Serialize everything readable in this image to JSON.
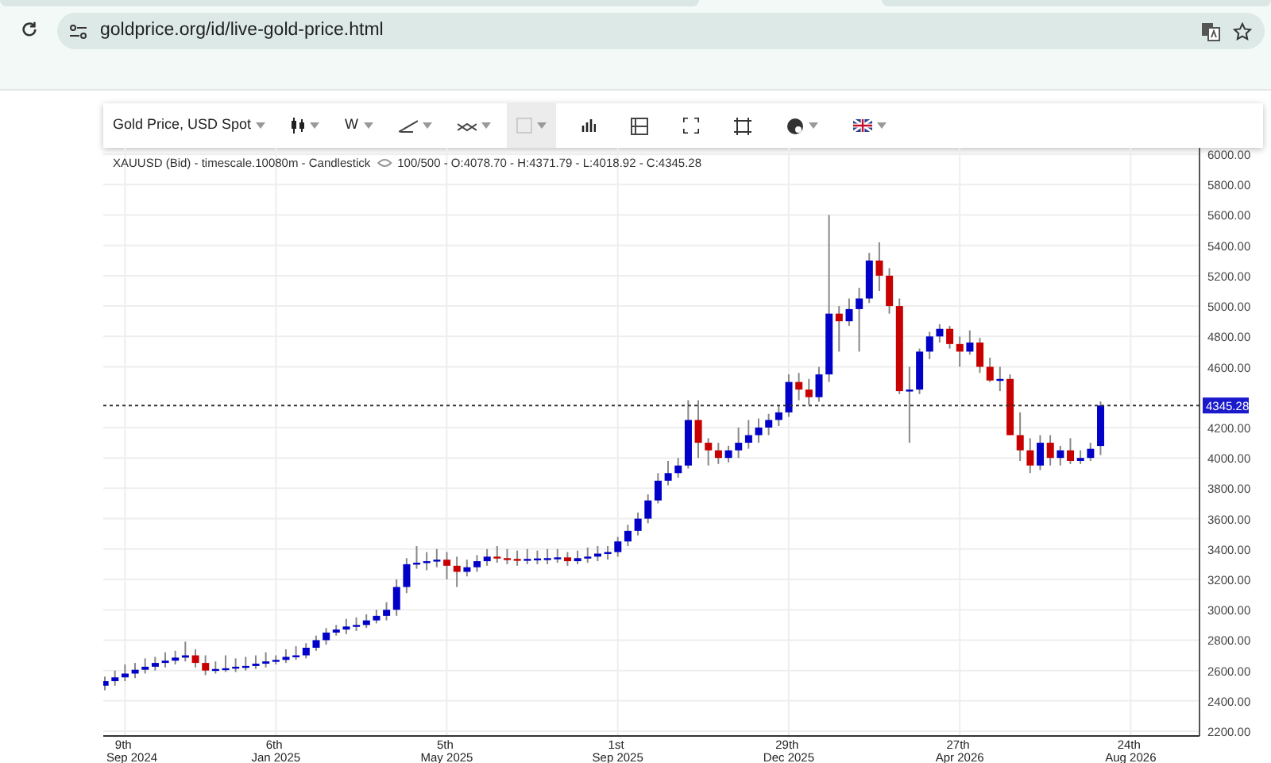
{
  "browser": {
    "url": "goldprice.org/id/live-gold-price.html"
  },
  "toolbar": {
    "symbol": "Gold Price, USD Spot",
    "interval": "W"
  },
  "chart": {
    "legend": "XAUUSD (Bid) - timescale.10080m - Candlestick",
    "legend_values": "100/500 - O:4078.70 - H:4371.79 - L:4018.92 - C:4345.28",
    "chart_data": {
      "type": "candlestick",
      "ylim": [
        2169,
        6042
      ],
      "grid": true,
      "ref_lines": [
        {
          "axis": "y",
          "value": 4345.28,
          "label": "4345.28"
        }
      ],
      "categories": [
        null,
        null,
        "9th Sep 2024",
        null,
        null,
        null,
        null,
        null,
        null,
        null,
        null,
        null,
        null,
        null,
        null,
        null,
        null,
        "6th Jan 2025",
        null,
        null,
        null,
        null,
        null,
        null,
        null,
        null,
        null,
        null,
        null,
        null,
        null,
        null,
        null,
        null,
        "5th May 2025",
        null,
        null,
        null,
        null,
        null,
        null,
        null,
        null,
        null,
        null,
        null,
        null,
        null,
        null,
        null,
        null,
        "1st Sep 2025",
        null,
        null,
        null,
        null,
        null,
        null,
        null,
        null,
        null,
        null,
        null,
        null,
        null,
        null,
        null,
        null,
        "29th Dec 2025",
        null,
        null,
        null,
        null,
        null,
        null,
        null,
        null,
        null,
        null,
        null,
        null,
        null,
        null,
        null,
        null,
        "27th Apr 2026",
        null,
        null,
        null,
        null,
        null,
        null,
        null,
        null,
        null,
        null,
        null,
        null,
        null,
        null,
        null,
        null,
        "24th Aug 2026",
        null,
        null,
        null,
        null,
        null,
        null
      ],
      "yticks": [
        {
          "value": 6000,
          "label": "6000.00"
        },
        {
          "value": 5800,
          "label": "5800.00"
        },
        {
          "value": 5600,
          "label": "5600.00"
        },
        {
          "value": 5400,
          "label": "5400.00"
        },
        {
          "value": 5200,
          "label": "5200.00"
        },
        {
          "value": 5000,
          "label": "5000.00"
        },
        {
          "value": 4800,
          "label": "4800.00"
        },
        {
          "value": 4600,
          "label": "4600.00"
        },
        {
          "value": 4200,
          "label": "4200.00"
        },
        {
          "value": 4000,
          "label": "4000.00"
        },
        {
          "value": 3800,
          "label": "3800.00"
        },
        {
          "value": 3600,
          "label": "3600.00"
        },
        {
          "value": 3400,
          "label": "3400.00"
        },
        {
          "value": 3200,
          "label": "3200.00"
        },
        {
          "value": 3000,
          "label": "3000.00"
        },
        {
          "value": 2800,
          "label": "2800.00"
        },
        {
          "value": 2600,
          "label": "2600.00"
        },
        {
          "value": 2400,
          "label": "2400.00"
        },
        {
          "value": 2200,
          "label": "2200.00"
        }
      ],
      "ohlc": [
        [
          2500,
          2560,
          2470,
          2530
        ],
        [
          2530,
          2600,
          2500,
          2555
        ],
        [
          2555,
          2640,
          2530,
          2580
        ],
        [
          2580,
          2650,
          2550,
          2605
        ],
        [
          2605,
          2680,
          2580,
          2625
        ],
        [
          2625,
          2690,
          2600,
          2650
        ],
        [
          2650,
          2720,
          2620,
          2665
        ],
        [
          2665,
          2730,
          2640,
          2685
        ],
        [
          2685,
          2790,
          2660,
          2700
        ],
        [
          2700,
          2740,
          2620,
          2650
        ],
        [
          2650,
          2700,
          2570,
          2600
        ],
        [
          2600,
          2660,
          2580,
          2610
        ],
        [
          2610,
          2700,
          2590,
          2615
        ],
        [
          2615,
          2680,
          2590,
          2625
        ],
        [
          2625,
          2690,
          2600,
          2630
        ],
        [
          2630,
          2700,
          2610,
          2645
        ],
        [
          2645,
          2720,
          2620,
          2660
        ],
        [
          2660,
          2700,
          2640,
          2670
        ],
        [
          2670,
          2740,
          2650,
          2690
        ],
        [
          2690,
          2760,
          2670,
          2700
        ],
        [
          2700,
          2780,
          2680,
          2750
        ],
        [
          2750,
          2830,
          2730,
          2800
        ],
        [
          2800,
          2880,
          2770,
          2850
        ],
        [
          2850,
          2900,
          2830,
          2870
        ],
        [
          2870,
          2940,
          2840,
          2890
        ],
        [
          2890,
          2950,
          2860,
          2900
        ],
        [
          2900,
          2970,
          2880,
          2930
        ],
        [
          2930,
          3000,
          2910,
          2960
        ],
        [
          2960,
          3050,
          2930,
          3000
        ],
        [
          3000,
          3200,
          2960,
          3150
        ],
        [
          3150,
          3340,
          3110,
          3300
        ],
        [
          3300,
          3420,
          3270,
          3310
        ],
        [
          3310,
          3380,
          3260,
          3320
        ],
        [
          3320,
          3400,
          3280,
          3330
        ],
        [
          3330,
          3380,
          3200,
          3290
        ],
        [
          3290,
          3350,
          3150,
          3250
        ],
        [
          3250,
          3330,
          3220,
          3280
        ],
        [
          3280,
          3360,
          3250,
          3320
        ],
        [
          3320,
          3400,
          3290,
          3350
        ],
        [
          3350,
          3420,
          3310,
          3340
        ],
        [
          3340,
          3400,
          3300,
          3335
        ],
        [
          3335,
          3390,
          3290,
          3330
        ],
        [
          3330,
          3400,
          3300,
          3335
        ],
        [
          3335,
          3390,
          3300,
          3338
        ],
        [
          3338,
          3400,
          3300,
          3340
        ],
        [
          3340,
          3400,
          3310,
          3345
        ],
        [
          3345,
          3380,
          3290,
          3320
        ],
        [
          3320,
          3390,
          3300,
          3340
        ],
        [
          3340,
          3410,
          3310,
          3350
        ],
        [
          3350,
          3420,
          3320,
          3370
        ],
        [
          3370,
          3420,
          3330,
          3380
        ],
        [
          3380,
          3480,
          3350,
          3450
        ],
        [
          3450,
          3560,
          3420,
          3520
        ],
        [
          3520,
          3640,
          3490,
          3600
        ],
        [
          3600,
          3760,
          3570,
          3720
        ],
        [
          3720,
          3900,
          3700,
          3850
        ],
        [
          3850,
          3980,
          3820,
          3900
        ],
        [
          3900,
          4000,
          3870,
          3950
        ],
        [
          3950,
          4380,
          3930,
          4250
        ],
        [
          4250,
          4380,
          4000,
          4100
        ],
        [
          4100,
          4130,
          3950,
          4050
        ],
        [
          4050,
          4100,
          3960,
          4000
        ],
        [
          4000,
          4080,
          3970,
          4050
        ],
        [
          4050,
          4200,
          4000,
          4100
        ],
        [
          4100,
          4250,
          4060,
          4150
        ],
        [
          4150,
          4260,
          4100,
          4200
        ],
        [
          4200,
          4290,
          4150,
          4250
        ],
        [
          4250,
          4340,
          4210,
          4300
        ],
        [
          4300,
          4550,
          4270,
          4500
        ],
        [
          4500,
          4560,
          4380,
          4450
        ],
        [
          4450,
          4520,
          4350,
          4400
        ],
        [
          4400,
          4600,
          4370,
          4550
        ],
        [
          4550,
          5600,
          4500,
          4950
        ],
        [
          4950,
          5000,
          4700,
          4900
        ],
        [
          4900,
          5050,
          4870,
          4980
        ],
        [
          4980,
          5120,
          4700,
          5050
        ],
        [
          5050,
          5350,
          5020,
          5300
        ],
        [
          5300,
          5420,
          5100,
          5200
        ],
        [
          5200,
          5250,
          4950,
          5000
        ],
        [
          5000,
          5050,
          4420,
          4440
        ],
        [
          4440,
          4600,
          4100,
          4450
        ],
        [
          4450,
          4720,
          4420,
          4700
        ],
        [
          4700,
          4830,
          4650,
          4800
        ],
        [
          4800,
          4880,
          4760,
          4850
        ],
        [
          4850,
          4870,
          4720,
          4750
        ],
        [
          4750,
          4800,
          4600,
          4700
        ],
        [
          4700,
          4840,
          4680,
          4760
        ],
        [
          4760,
          4790,
          4560,
          4600
        ],
        [
          4600,
          4660,
          4500,
          4510
        ],
        [
          4510,
          4600,
          4440,
          4520
        ],
        [
          4520,
          4550,
          4150,
          4150
        ],
        [
          4150,
          4300,
          3980,
          4050
        ],
        [
          4050,
          4130,
          3900,
          3950
        ],
        [
          3950,
          4150,
          3920,
          4100
        ],
        [
          4100,
          4150,
          3950,
          4000
        ],
        [
          4000,
          4080,
          3950,
          4050
        ],
        [
          4050,
          4130,
          3960,
          3980
        ],
        [
          3980,
          4050,
          3960,
          4000
        ],
        [
          4000,
          4100,
          3980,
          4060
        ],
        [
          4078.7,
          4371.79,
          4018.92,
          4345.28
        ],
        null,
        null,
        null,
        null,
        null,
        null,
        null,
        null,
        null
      ]
    }
  }
}
